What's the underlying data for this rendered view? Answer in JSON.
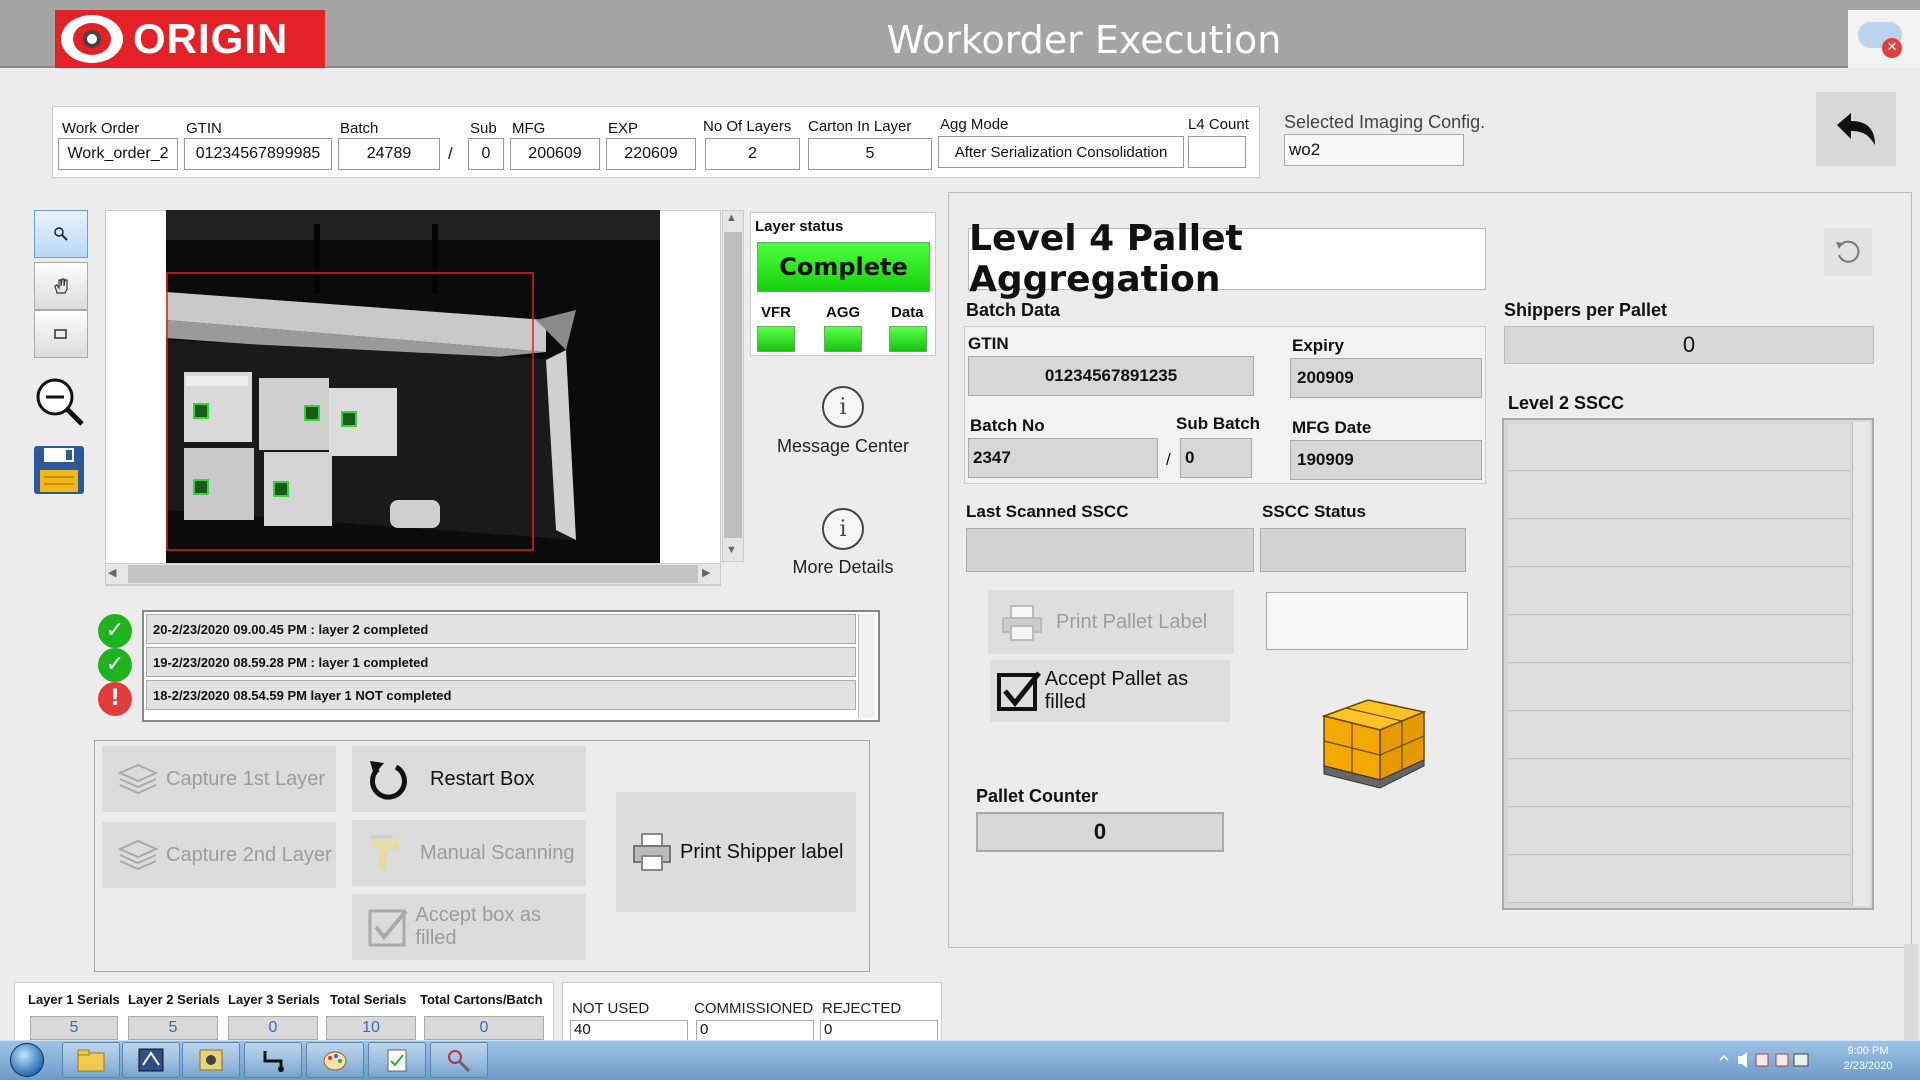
{
  "header": {
    "brand": "ORIGIN",
    "title": "Workorder Execution",
    "notification_icon": "cloud-error-icon"
  },
  "workorder": {
    "labels": {
      "work_order": "Work Order",
      "gtin": "GTIN",
      "batch": "Batch",
      "sub": "Sub",
      "mfg": "MFG",
      "exp": "EXP",
      "no_of_layers": "No Of Layers",
      "carton_in_layer": "Carton In Layer",
      "agg_mode": "Agg Mode",
      "l4_count": "L4 Count"
    },
    "values": {
      "work_order": "Work_order_2",
      "gtin": "01234567899985",
      "batch": "24789",
      "sub": "0",
      "mfg": "200609",
      "exp": "220609",
      "no_of_layers": "2",
      "carton_in_layer": "5",
      "agg_mode": "After Serialization Consolidation",
      "l4_count": ""
    },
    "separator": "/"
  },
  "imaging_config": {
    "label": "Selected Imaging Config.",
    "value": "wo2"
  },
  "layer_status": {
    "title": "Layer status",
    "status": "Complete",
    "indicators": [
      {
        "label": "VFR"
      },
      {
        "label": "AGG"
      },
      {
        "label": "Data"
      }
    ],
    "status_color": "#22dd11"
  },
  "side_links": {
    "message_center": "Message Center",
    "more_details": "More Details"
  },
  "log": [
    {
      "status": "ok",
      "text": "20-2/23/2020 09.00.45 PM : layer 2  completed"
    },
    {
      "status": "ok",
      "text": "19-2/23/2020 08.59.28 PM : layer 1 completed"
    },
    {
      "status": "error",
      "text": "18-2/23/2020 08.54.59 PM  layer 1 NOT completed"
    }
  ],
  "actions": {
    "capture_1st": "Capture 1st Layer",
    "capture_2nd": "Capture 2nd Layer",
    "restart_box": "Restart Box",
    "manual_scanning": "Manual Scanning",
    "accept_box": "Accept box as filled",
    "print_shipper": "Print Shipper label"
  },
  "stats": {
    "labels": [
      "Layer 1 Serials",
      "Layer 2 Serials",
      "Layer 3 Serials",
      "Total Serials",
      "Total Cartons/Batch"
    ],
    "values": [
      "5",
      "5",
      "0",
      "10",
      "0"
    ]
  },
  "serial_status": {
    "labels": [
      "NOT USED",
      "COMMISSIONED",
      "REJECTED"
    ],
    "values": [
      "40",
      "0",
      "0"
    ]
  },
  "aggregation": {
    "title": "Level 4 Pallet Aggregation",
    "batch_data_label": "Batch Data",
    "gtin_label": "GTIN",
    "gtin": "01234567891235",
    "expiry_label": "Expiry",
    "expiry": "200909",
    "batch_no_label": "Batch No",
    "batch_no": "2347",
    "sub_batch_label": "Sub Batch",
    "sub_batch": "0",
    "mfg_date_label": "MFG Date",
    "mfg_date": "190909",
    "separator": "/",
    "last_sscc_label": "Last Scanned SSCC",
    "last_sscc": "",
    "sscc_status_label": "SSCC Status",
    "sscc_status": "",
    "print_pallet": "Print Pallet Label",
    "accept_pallet": "Accept Pallet as filled",
    "pallet_counter_label": "Pallet Counter",
    "pallet_counter": "0",
    "shippers_per_pallet_label": "Shippers per Pallet",
    "shippers_per_pallet": "0",
    "level2_sscc_label": "Level 2 SSCC",
    "level2_sscc_rows": [
      "",
      "",
      "",
      "",
      "",
      "",
      "",
      "",
      "",
      ""
    ]
  },
  "taskbar": {
    "apps": [
      "explorer-icon",
      "app-icon-2",
      "app-icon-3",
      "network-icon",
      "paint-icon",
      "notepad-icon",
      "tool-icon"
    ],
    "time": "9:00 PM",
    "date": "2/23/2020"
  }
}
